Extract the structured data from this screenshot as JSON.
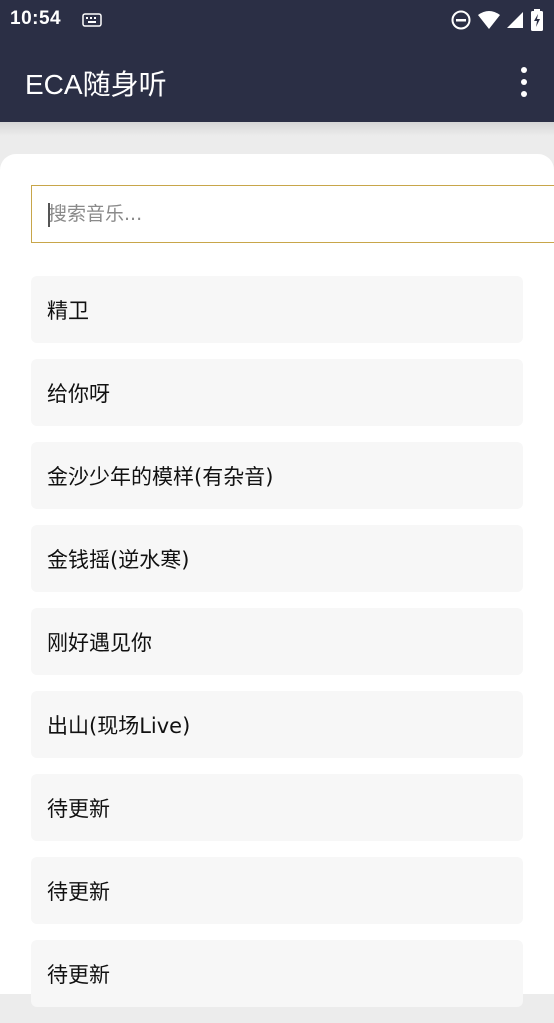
{
  "status_bar": {
    "time": "10:54",
    "icons": [
      "keyboard-icon",
      "do-not-disturb-icon",
      "wifi-icon",
      "cellular-signal-icon",
      "battery-icon"
    ]
  },
  "app_bar": {
    "title": "ECA随身听",
    "menu_icon": "more-vert-icon"
  },
  "search": {
    "placeholder": "搜索音乐...",
    "value": ""
  },
  "songs": [
    "精卫",
    "给你呀",
    "金沙少年的模样(有杂音)",
    "金钱摇(逆水寒)",
    "刚好遇见你",
    "出山(现场Live)",
    "待更新",
    "待更新",
    "待更新"
  ],
  "colors": {
    "app_bar": "#2b2f45",
    "search_border": "#c8a64a",
    "list_item_bg": "#f7f7f7",
    "page_bg": "#ececec"
  }
}
